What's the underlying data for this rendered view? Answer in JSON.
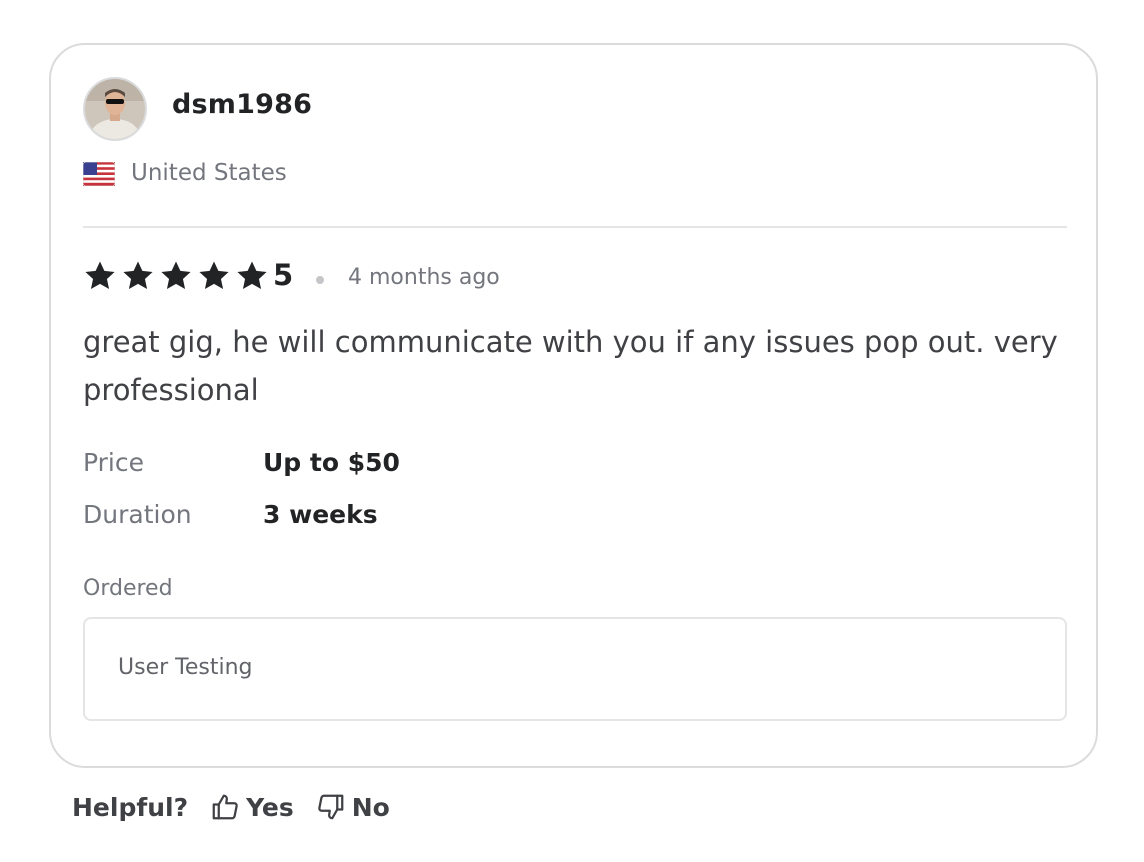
{
  "review": {
    "username": "dsm1986",
    "country": "United States",
    "flag_icon": "us-flag-icon",
    "rating": "5",
    "rating_stars": 5,
    "time_ago": "4 months ago",
    "text": "great gig, he will communicate with you if any issues pop out. very professional",
    "details": [
      {
        "label": "Price",
        "value": "Up to $50"
      },
      {
        "label": "Duration",
        "value": "3 weeks"
      }
    ],
    "ordered_label": "Ordered",
    "ordered_item": "User Testing"
  },
  "helpful": {
    "label": "Helpful?",
    "yes_label": "Yes",
    "no_label": "No",
    "yes_icon": "thumbs-up-icon",
    "no_icon": "thumbs-down-icon"
  },
  "colors": {
    "star": "#222325",
    "border": "#dadbdd",
    "muted_text": "#74767e"
  }
}
